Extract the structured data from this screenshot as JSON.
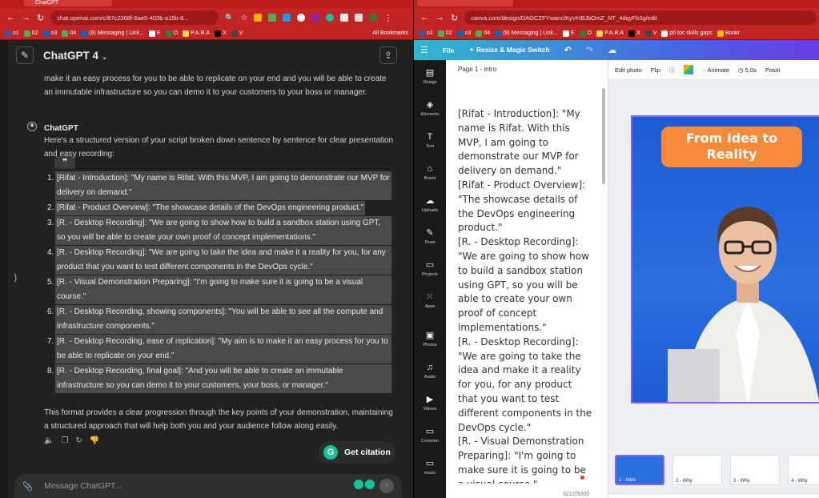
{
  "chatgpt_window": {
    "tab_title": "ChatGPT",
    "url": "chat.openai.com/c/87c2368f-6ae5-403b-a15b-8...",
    "bookmarks": [
      "o1",
      "02",
      "o3",
      "04",
      "(9) Messaging | Link...",
      "E",
      "O",
      "P.A.R.A",
      "X",
      "V"
    ],
    "all_bookmarks": "All Bookmarks",
    "model": "ChatGPT 4",
    "prev_message": "make it an easy process for you to be able to replicate on your end and you will be able to create an immutable infrastructure so you can demo it to your customers to your boss or manager.",
    "author": "ChatGPT",
    "intro": "Here's a structured version of your script broken down sentence by sentence for clear presentation and easy recording:",
    "items": [
      {
        "num": "1.",
        "text": "[Rifat - Introduction]: \"My name is Rifat. With this MVP, I am going to demonstrate our MVP for delivery on demand.\""
      },
      {
        "num": "2.",
        "text": "[Rifat - Product Overview]: \"The showcase details of the DevOps engineering product.\""
      },
      {
        "num": "3.",
        "text": "[R. - Desktop Recording]: \"We are going to show how to build a sandbox station using GPT, so you will be able to create your own proof of concept implementations.\""
      },
      {
        "num": "4.",
        "text": "[R. - Desktop Recording]: \"We are going to take the idea and make it a reality for you, for any product that you want to test different components in the DevOps cycle.\""
      },
      {
        "num": "5.",
        "text": "[R. - Visual Demonstration Preparing]: \"I'm going to make sure it is going to be a visual course.\""
      },
      {
        "num": "6.",
        "text": "[R. - Desktop Recording, showing components]: \"You will be able to see all the compute and infrastructure components.\""
      },
      {
        "num": "7.",
        "text": "[R. - Desktop Recording, ease of replication]: \"My aim is to make it an easy process for you to be able to replicate on your end.\""
      },
      {
        "num": "8.",
        "text": "[R. - Desktop Recording, final goal]: \"And you will be able to create an immutable infrastructure so you can demo it to your customers, your boss, or manager.\""
      }
    ],
    "outro": "This format provides a clear progression through the key points of your demonstration, maintaining a structured approach that will help both you and your audience follow along easily.",
    "citation_button": "Get citation",
    "composer_placeholder": "Message ChatGPT..."
  },
  "canva_window": {
    "url": "canva.com/design/DAGCZFYwanc/KyVHBJbOmZ_NT_4dqyFb3g/edit",
    "bookmarks": [
      "o1",
      "02",
      "o3",
      "04",
      "(9) Messaging | Link...",
      "E",
      "O",
      "P.A.R.A",
      "X",
      "V",
      "p0 toc skills gaps",
      "Bookr"
    ],
    "header": {
      "file": "File",
      "resize": "Resize & Magic Switch"
    },
    "rail": [
      "Design",
      "Elements",
      "Text",
      "Brand",
      "Uploads",
      "Draw",
      "Projects",
      "Apps",
      "Photos",
      "Audio",
      "Videos",
      "Common",
      "music"
    ],
    "page_title": "Page 1 - intro",
    "notes": "[Rifat - Introduction]: \"My name is Rifat. With this MVP, I am going to demonstrate our MVP for delivery on demand.\"\n[Rifat - Product Overview]: \"The showcase details of the DevOps engineering product.\"\n[R. - Desktop Recording]: \"We are going to show how to build a sandbox station using GPT, so you will be able to create your own proof of concept implementations.\"\n[R. - Desktop Recording]: \"We are going to take the idea and make it a reality for you, for any product that you want to test different components in the DevOps cycle.\"\n[R. - Visual Demonstration Preparing]: \"I'm going to make sure it is going to be a visual course.\"\n[R. - Desktop Recording",
    "char_count": "3212/5000",
    "toolbar": {
      "edit_photo": "Edit photo",
      "flip": "Flip",
      "animate": "Animate",
      "duration": "5.0s",
      "position": "Positi"
    },
    "slide_title": "From Idea to Reality",
    "thumbs": [
      "1 - Intro",
      "2 - Why",
      "3 - Why",
      "4 - Why"
    ]
  }
}
